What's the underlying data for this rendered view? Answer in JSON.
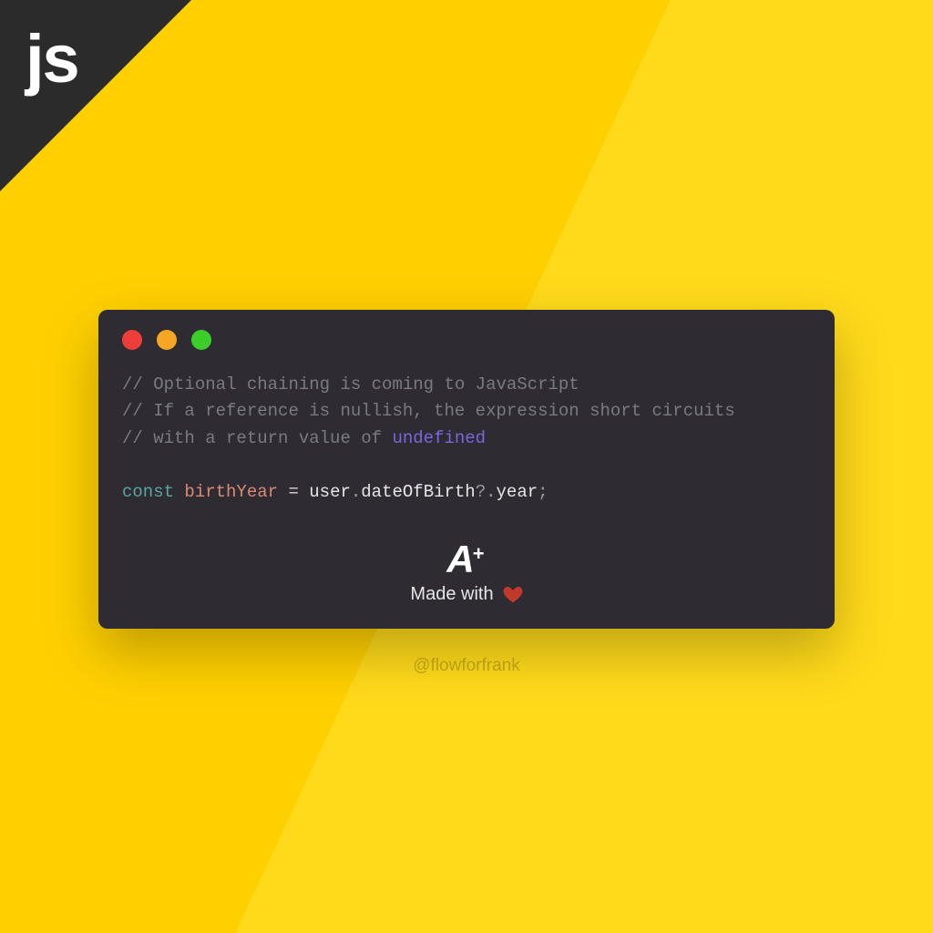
{
  "corner": {
    "label": "js"
  },
  "traffic": {
    "red": "#ed3e3a",
    "yellow": "#f5a623",
    "green": "#3bce29"
  },
  "code": {
    "comment1_prefix": "// ",
    "comment1": "Optional chaining is coming to JavaScript",
    "comment2_prefix": "// ",
    "comment2": "If a reference is nullish, the expression short circuits",
    "comment3_prefix": "// ",
    "comment3_a": "with a return value of ",
    "comment3_keyword": "undefined",
    "line": {
      "const": "const",
      "space1": " ",
      "varname": "birthYear",
      "space2": " ",
      "eq": "=",
      "space3": " ",
      "obj": "user",
      "dot1": ".",
      "prop": "dateOfBirth",
      "opt": "?.",
      "year": "year",
      "semi": ";"
    }
  },
  "footer": {
    "logo_a": "A",
    "logo_plus": "+",
    "made_with": "Made with"
  },
  "handle": "@flowforfrank"
}
